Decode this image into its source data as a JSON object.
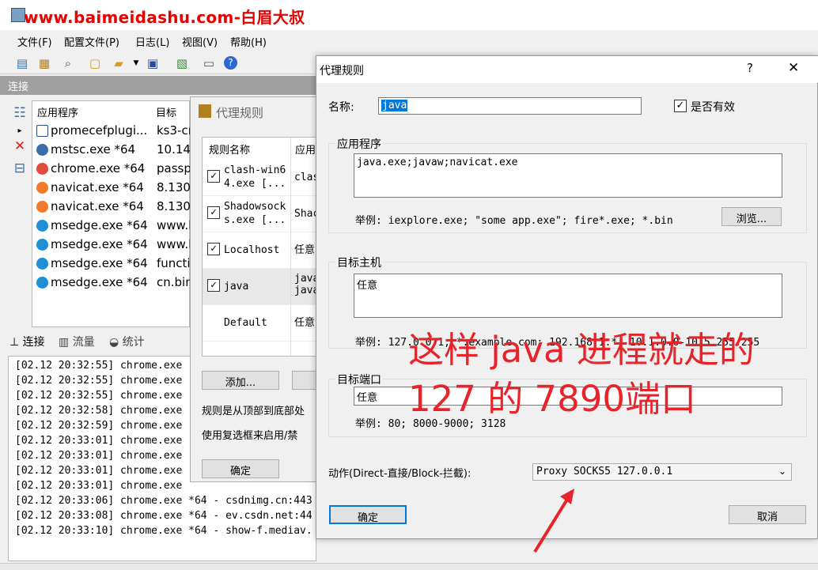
{
  "watermark": "www.baimeidashu.com-白眉大叔",
  "menu": [
    "文件(F)",
    "配置文件(P)",
    "日志(L)",
    "视图(V)",
    "帮助(H)"
  ],
  "conn_header": "连接",
  "conn_columns": [
    "应用程序",
    "目标"
  ],
  "connections": [
    {
      "app": "promecefplugi...",
      "target": "ks3-cr",
      "icon_color": "#ffffff"
    },
    {
      "app": "mstsc.exe *64",
      "target": "10.147",
      "icon_color": "#3a6ea5"
    },
    {
      "app": "chrome.exe *64",
      "target": "passp",
      "icon_color": "#e04a3a"
    },
    {
      "app": "navicat.exe *64",
      "target": "8.130.",
      "icon_color": "#f07a2a"
    },
    {
      "app": "navicat.exe *64",
      "target": "8.130.",
      "icon_color": "#f07a2a"
    },
    {
      "app": "msedge.exe *64",
      "target": "www.l",
      "icon_color": "#1e8fd6"
    },
    {
      "app": "msedge.exe *64",
      "target": "www.l",
      "icon_color": "#1e8fd6"
    },
    {
      "app": "msedge.exe *64",
      "target": "functic",
      "icon_color": "#1e8fd6"
    },
    {
      "app": "msedge.exe *64",
      "target": "cn.bin",
      "icon_color": "#1e8fd6"
    }
  ],
  "tabs": [
    "连接",
    "流量",
    "统计"
  ],
  "log": [
    "[02.12 20:32:55] chrome.exe",
    "[02.12 20:32:55] chrome.exe",
    "[02.12 20:32:55] chrome.exe",
    "[02.12 20:32:58] chrome.exe",
    "[02.12 20:32:59] chrome.exe",
    "[02.12 20:33:01] chrome.exe",
    "[02.12 20:33:01] chrome.exe",
    "[02.12 20:33:01] chrome.exe",
    "[02.12 20:33:01] chrome.exe",
    "[02.12 20:33:06] chrome.exe *64 - csdnimg.cn:443",
    "[02.12 20:33:08] chrome.exe *64 - ev.csdn.net:44",
    "[02.12 20:33:10] chrome.exe *64 - show-f.mediav."
  ],
  "rules_dialog": {
    "title": "代理规则",
    "columns": [
      "规则名称",
      "应用"
    ],
    "rules": [
      {
        "name_line1": "clash-win6",
        "name_line2": "4.exe [...",
        "app": "clas",
        "checked": true
      },
      {
        "name_line1": "Shadowsock",
        "name_line2": "s.exe [...",
        "app": "Shac",
        "checked": true
      },
      {
        "name_line1": "Localhost",
        "name_line2": "",
        "app": "任意",
        "checked": true
      },
      {
        "name_line1": "java",
        "name_line2": "",
        "app": "java\njava",
        "checked": true
      },
      {
        "name_line1": "Default",
        "name_line2": "",
        "app": "任意",
        "checked": false
      }
    ],
    "add_button": "添加...",
    "note1": "规则是从顶部到底部处",
    "note2": "使用复选框来启用/禁",
    "ok_button": "确定"
  },
  "edit_dialog": {
    "title": "代理规则",
    "help": "?",
    "close": "✕",
    "name_label": "名称:",
    "name_value": "java",
    "enabled_label": "是否有效",
    "enabled": true,
    "apps_group": "应用程序",
    "apps_value": "java.exe;javaw;navicat.exe",
    "apps_hint": "举例: iexplore.exe; \"some app.exe\"; fire*.exe; *.bin",
    "browse_button": "浏览...",
    "hosts_group": "目标主机",
    "hosts_value": "任意",
    "hosts_hint": "举例: 127.0.0.1; *.example.com; 192.168.1.*; 10.1.0.0-10.5.255.255",
    "ports_group": "目标端口",
    "ports_value": "任意",
    "ports_hint": "举例: 80; 8000-9000; 3128",
    "action_label": "动作(Direct-直接/Block-拦截):",
    "action_value": "Proxy SOCKS5 127.0.0.1",
    "ok_button": "确定",
    "cancel_button": "取消"
  },
  "annotation": {
    "line1": "这样 java 进程就走的",
    "line2": "127 的 7890端口",
    "color": "#e8232a"
  }
}
